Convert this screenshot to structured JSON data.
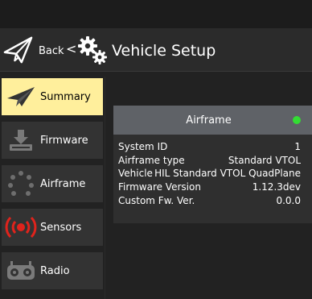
{
  "header": {
    "back_label": "Back",
    "separator": "<",
    "title": "Vehicle Setup"
  },
  "sidebar": {
    "items": [
      {
        "label": "Summary",
        "icon": "paper-plane-icon",
        "active": true
      },
      {
        "label": "Firmware",
        "icon": "download-icon",
        "active": false
      },
      {
        "label": "Airframe",
        "icon": "airframe-icon",
        "active": false
      },
      {
        "label": "Sensors",
        "icon": "sensors-icon",
        "active": false
      },
      {
        "label": "Radio",
        "icon": "radio-controller-icon",
        "active": false
      }
    ]
  },
  "airframe_panel": {
    "title": "Airframe",
    "status_color": "#33dd33",
    "rows": [
      {
        "label": "System ID",
        "value": "1"
      },
      {
        "label": "Airframe type",
        "value": "Standard VTOL"
      },
      {
        "label": "Vehicle",
        "value": "HIL Standard VTOL QuadPlane"
      },
      {
        "label": "Firmware Version",
        "value": "1.12.3dev"
      },
      {
        "label": "Custom Fw. Ver.",
        "value": "0.0.0"
      }
    ]
  },
  "colors": {
    "active_nav": "#ffef9c",
    "panel_header": "#5f6267",
    "sensors_red": "#e0231c"
  }
}
